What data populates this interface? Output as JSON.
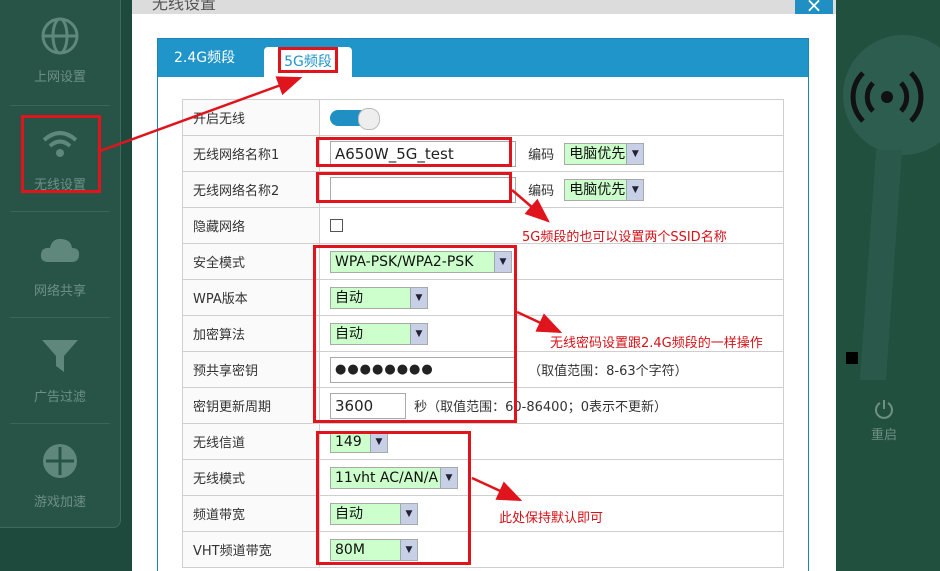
{
  "sidebar": {
    "items": [
      {
        "label": "上网设置",
        "icon": "globe-icon"
      },
      {
        "label": "无线设置",
        "icon": "wifi-icon"
      },
      {
        "label": "网络共享",
        "icon": "cloud-icon"
      },
      {
        "label": "广告过滤",
        "icon": "filter-icon"
      },
      {
        "label": "游戏加速",
        "icon": "gamepad-icon"
      }
    ]
  },
  "right_panel": {
    "power_label": "重启"
  },
  "modal": {
    "title": "无线设置",
    "close_label": "×",
    "tabs": [
      {
        "label": "2.4G频段",
        "active": false
      },
      {
        "label": "5G频段",
        "active": true
      }
    ]
  },
  "form": {
    "enable_label": "开启无线",
    "ssid1_label": "无线网络名称1",
    "ssid1_value": "A650W_5G_test",
    "encoding_label": "编码",
    "encoding1_value": "电脑优先",
    "ssid2_label": "无线网络名称2",
    "ssid2_value": "",
    "encoding2_value": "电脑优先",
    "hidden_label": "隐藏网络",
    "security_label": "安全模式",
    "security_value": "WPA-PSK/WPA2-PSK",
    "wpa_label": "WPA版本",
    "wpa_value": "自动",
    "cipher_label": "加密算法",
    "cipher_value": "自动",
    "psk_label": "预共享密钥",
    "psk_value": "●●●●●●●●",
    "psk_hint": "（取值范围：8-63个字符）",
    "rekey_label": "密钥更新周期",
    "rekey_value": "3600",
    "rekey_hint": "秒（取值范围：60-86400；0表示不更新）",
    "channel_label": "无线信道",
    "channel_value": "149",
    "mode_label": "无线模式",
    "mode_value": "11vht AC/AN/A",
    "bandwidth_label": "频道带宽",
    "bandwidth_value": "自动",
    "vht_label": "VHT频道带宽",
    "vht_value": "80M"
  },
  "annotations": {
    "ssid_note": "5G频段的也可以设置两个SSID名称",
    "password_note": "无线密码设置跟2.4G频段的一样操作",
    "default_note": "此处保持默认即可"
  },
  "colors": {
    "accent": "#1f95c9",
    "annotation_red": "#e0141c",
    "select_bg": "#ccffcc"
  }
}
